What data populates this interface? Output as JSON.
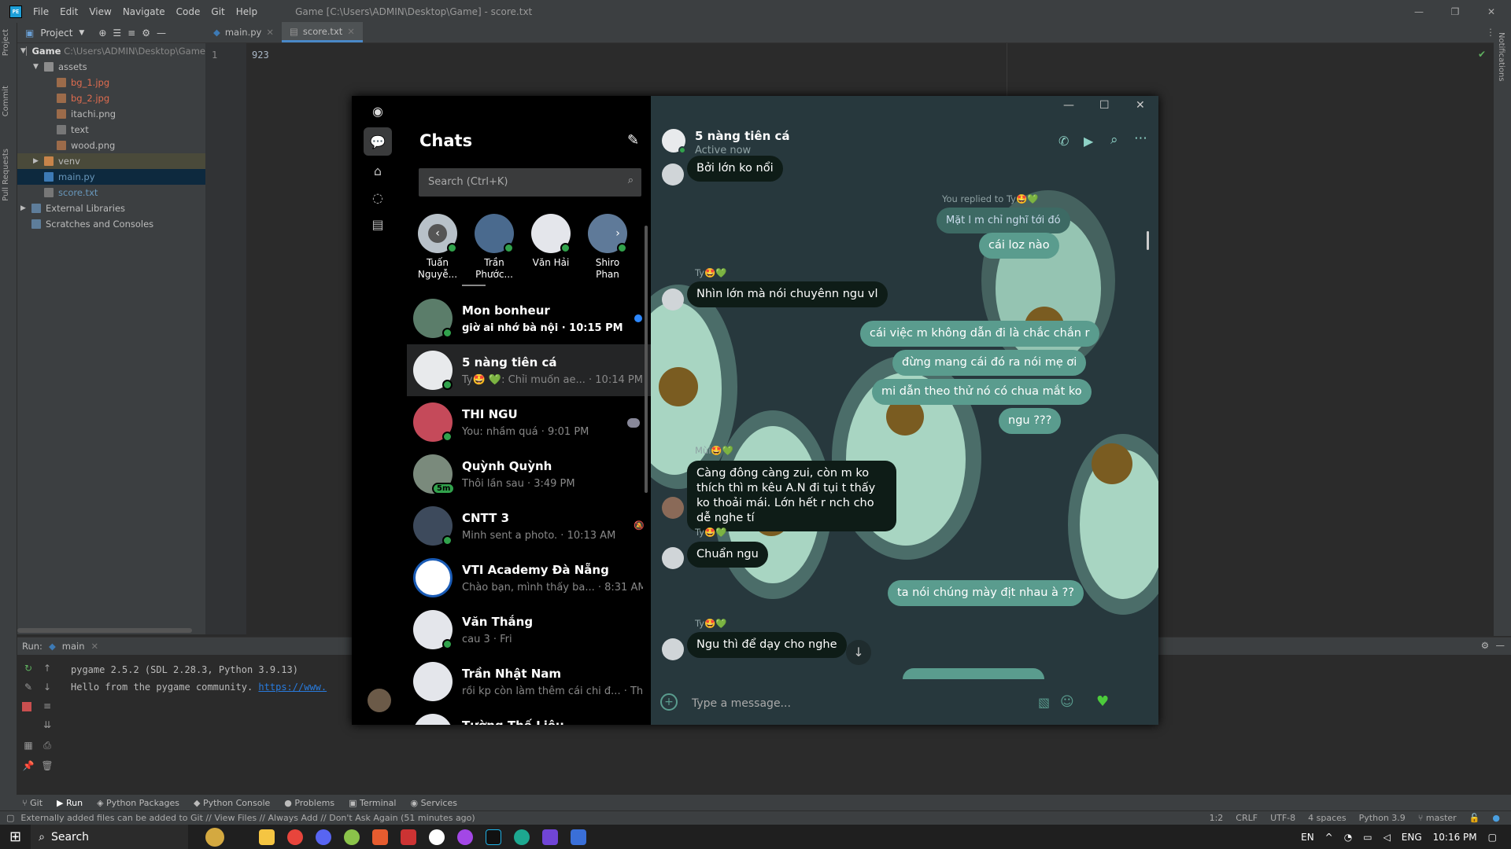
{
  "ide": {
    "menu": [
      "File",
      "Edit",
      "View",
      "Navigate",
      "Code",
      "Git",
      "Help"
    ],
    "window_title": "Game [C:\\Users\\ADMIN\\Desktop\\Game] - score.txt",
    "left_tabs": [
      "Project",
      "Commit",
      "Pull Requests"
    ],
    "project_header": "Project",
    "tree": [
      {
        "label": "Game",
        "hint": "C:\\Users\\ADMIN\\Desktop\\Game",
        "level": 0
      },
      {
        "label": "assets",
        "level": 1
      },
      {
        "label": "bg_1.jpg",
        "level": 2
      },
      {
        "label": "bg_2.jpg",
        "level": 2
      },
      {
        "label": "itachi.png",
        "level": 2
      },
      {
        "label": "text",
        "level": 2
      },
      {
        "label": "wood.png",
        "level": 2
      },
      {
        "label": "venv",
        "level": 1
      },
      {
        "label": "main.py",
        "level": 1
      },
      {
        "label": "score.txt",
        "level": 1
      },
      {
        "label": "External Libraries",
        "level": 0
      },
      {
        "label": "Scratches and Consoles",
        "level": 0
      }
    ],
    "tabs": [
      "main.py",
      "score.txt"
    ],
    "line_number": "1",
    "code_line": "923",
    "run_label": "Run:",
    "run_config": "main",
    "run_output": [
      "pygame 2.5.2 (SDL 2.28.3, Python 3.9.13)",
      "Hello from the pygame community. "
    ],
    "run_link": "https://www.",
    "tool_windows": [
      "Git",
      "Run",
      "Python Packages",
      "Python Console",
      "Problems",
      "Terminal",
      "Services"
    ],
    "status_msg": "Externally added files can be added to Git // View Files // Always Add // Don't Ask Again (51 minutes ago)",
    "status_right": [
      "1:2",
      "CRLF",
      "UTF-8",
      "4 spaces",
      "Python 3.9",
      "master"
    ],
    "notifications": "Notifications"
  },
  "taskbar": {
    "search": "Search",
    "lang": "EN",
    "ime": "ENG",
    "time": "10:16 PM"
  },
  "messenger": {
    "chats_title": "Chats",
    "search_placeholder": "Search (Ctrl+K)",
    "stories": [
      {
        "name": "Tuấn Nguyễ..."
      },
      {
        "name": "Trần Phước..."
      },
      {
        "name": "Văn Hải"
      },
      {
        "name": "Shiro Phan"
      }
    ],
    "chat_list": [
      {
        "name": "Mon bonheur",
        "preview": "giờ ai nhớ bà nội · 10:15 PM",
        "unread": true
      },
      {
        "name": "5 nàng tiên cá",
        "preview": "Ty🤩 💚: Chỉi muốn ae... · 10:14 PM",
        "unread": false
      },
      {
        "name": "THI NGU",
        "preview": "You: nhầm quá · 9:01 PM",
        "unread": false
      },
      {
        "name": "Quỳnh Quỳnh",
        "preview": "Thôi lần sau · 3:49 PM",
        "unread": false,
        "badge": "5m"
      },
      {
        "name": "CNTT 3",
        "preview": "Minh sent a photo. · 10:13 AM",
        "unread": false
      },
      {
        "name": "VTI Academy Đà Nẵng",
        "preview": "Chào bạn, mình thấy ba... · 8:31 AM",
        "unread": false
      },
      {
        "name": "Văn Thắng",
        "preview": "cau 3 · Fri",
        "unread": false
      },
      {
        "name": "Trần Nhật Nam",
        "preview": "rồi kp còn làm thêm cái chi đ... · Thu",
        "unread": false
      },
      {
        "name": "Tường Thế Liêu",
        "preview": "",
        "unread": false
      }
    ],
    "convo": {
      "title": "5 nàng tiên cá",
      "status": "Active now",
      "reply_note": "You replied to Ty🤩💚",
      "quoted": "Mặt l m chỉ nghĩ tới đó",
      "messages": [
        {
          "dir": "in",
          "text": "Bởi lớn ko nổi"
        },
        {
          "dir": "out",
          "text": "cái loz nào"
        },
        {
          "dir": "in",
          "sender": "Ty🤩💚",
          "text": "Nhìn lớn mà nói chuyênn ngu vl"
        },
        {
          "dir": "out",
          "text": "cái việc m không dẫn đi là chắc chắn r"
        },
        {
          "dir": "out",
          "text": "đừng mang cái đó ra nói mẹ ơi"
        },
        {
          "dir": "out",
          "text": "mi dẫn theo thử nó có chua mắt ko"
        },
        {
          "dir": "out",
          "text": "ngu ???"
        },
        {
          "dir": "in",
          "sender": "Mùi🤩💚",
          "text": "Càng đông càng zui, còn m ko thích thì m kêu A.N đi tụi t thấy ko thoải mái. Lớn hết r nch cho dễ nghe tí"
        },
        {
          "dir": "in",
          "sender": "Ty🤩💚",
          "text": "Chuẩn ngu"
        },
        {
          "dir": "out",
          "text": "ta nói chúng mày địt nhau à ??"
        },
        {
          "dir": "in",
          "sender": "Ty🤩💚",
          "text": "Ngu thì để dạy cho nghe"
        }
      ],
      "composer_placeholder": "Type a message..."
    }
  }
}
